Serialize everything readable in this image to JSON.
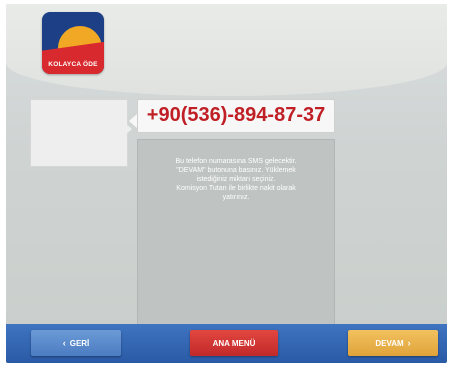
{
  "logo": {
    "text": "KOLAYCA ÖDE"
  },
  "phone": {
    "number": "+90(536)-894-87-37"
  },
  "info": {
    "lines": [
      "Bu telefon numarasına SMS gelecektir.",
      "\"DEVAM\" butonuna basınız. Yüklemek",
      "istediğiniz miktarı seçiniz.",
      "Komisyon Tutarı ile birlikte nakit olarak",
      "yatırınız."
    ]
  },
  "buttons": {
    "back": "GERİ",
    "menu": "ANA MENÜ",
    "next": "DEVAM"
  },
  "icons": {
    "back": "arrow-left-icon",
    "next": "arrow-right-icon"
  },
  "colors": {
    "accent_blue": "#2a5aa6",
    "brand_red": "#c01f25",
    "next_orange": "#e0a33a"
  }
}
